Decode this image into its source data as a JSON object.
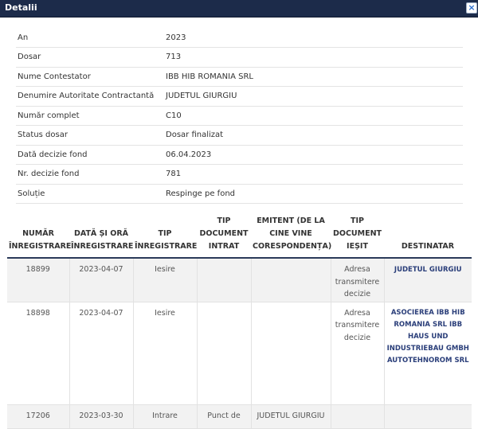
{
  "window": {
    "title": "Detalii",
    "close_glyph": "×"
  },
  "details": [
    {
      "label": "An",
      "value": "2023"
    },
    {
      "label": "Dosar",
      "value": "713"
    },
    {
      "label": "Nume Contestator",
      "value": "IBB HIB ROMANIA SRL"
    },
    {
      "label": "Denumire Autoritate Contractantă",
      "value": "JUDETUL GIURGIU"
    },
    {
      "label": "Număr complet",
      "value": "C10"
    },
    {
      "label": "Status dosar",
      "value": "Dosar finalizat"
    },
    {
      "label": "Dată decizie fond",
      "value": "06.04.2023"
    },
    {
      "label": "Nr. decizie fond",
      "value": "781"
    },
    {
      "label": "Soluție",
      "value": "Respinge pe fond"
    }
  ],
  "table": {
    "headers": [
      "NUMĂR ÎNREGISTRARE",
      "DATĂ ȘI ORĂ ÎNREGISTRARE",
      "TIP ÎNREGISTRARE",
      "TIP DOCUMENT INTRAT",
      "EMITENT (DE LA CINE VINE CORESPONDENȚA)",
      "TIP DOCUMENT IEȘIT",
      "DESTINATAR"
    ],
    "rows": [
      {
        "numar": "18899",
        "data": "2023-04-07",
        "tip": "Iesire",
        "doc_intrat": "",
        "emitent": "",
        "doc_iesit": "Adresa transmitere decizie",
        "destinatar": "JUDETUL GIURGIU"
      },
      {
        "numar": "18898",
        "data": "2023-04-07",
        "tip": "Iesire",
        "doc_intrat": "",
        "emitent": "",
        "doc_iesit": "Adresa transmitere decizie",
        "destinatar": "ASOCIEREA IBB HIB ROMANIA SRL IBB HAUS UND INDUSTRIEBAU GMBH AUTOTEHNOROM SRL"
      },
      {
        "numar": "17206",
        "data": "2023-03-30",
        "tip": "Intrare",
        "doc_intrat": "Punct de",
        "emitent": "JUDETUL GIURGIU",
        "doc_iesit": "",
        "destinatar": ""
      }
    ]
  }
}
